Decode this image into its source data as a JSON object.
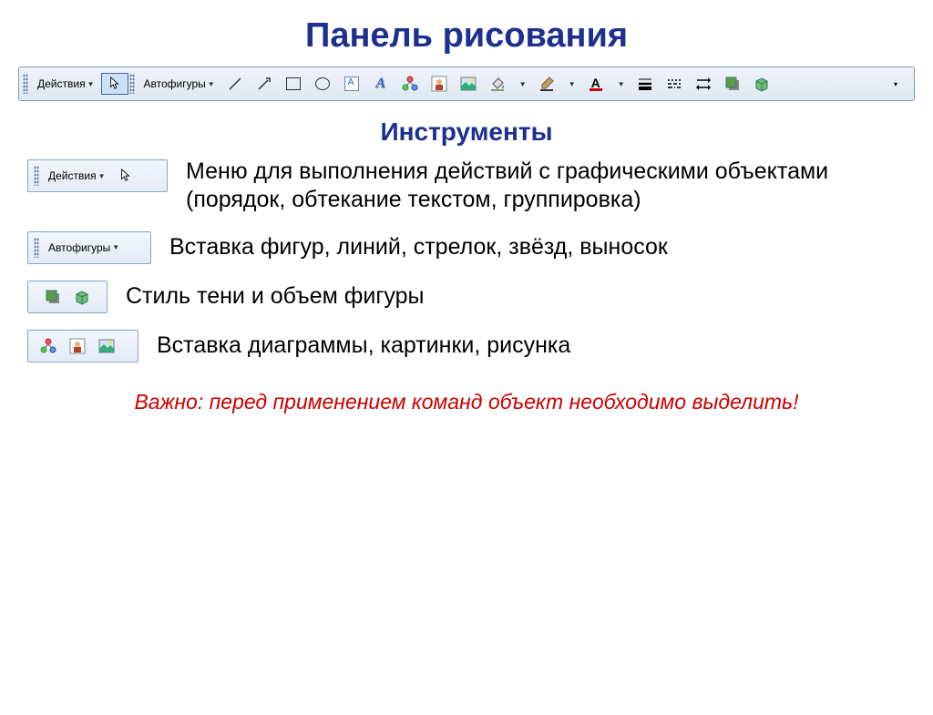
{
  "title": "Панель рисования",
  "subtitle": "Инструменты",
  "toolbar": {
    "actions_label": "Действия",
    "autoshapes_label": "Автофигуры"
  },
  "rows": [
    {
      "desc": "Меню для выполнения действий с графическими объектами (порядок, обтекание текстом, группировка)"
    },
    {
      "desc": "Вставка фигур, линий, стрелок, звёзд, выносок"
    },
    {
      "desc": "Стиль тени и объем фигуры"
    },
    {
      "desc": "Вставка диаграммы, картинки, рисунка"
    }
  ],
  "note": "Важно: перед применением команд объект необходимо выделить!"
}
